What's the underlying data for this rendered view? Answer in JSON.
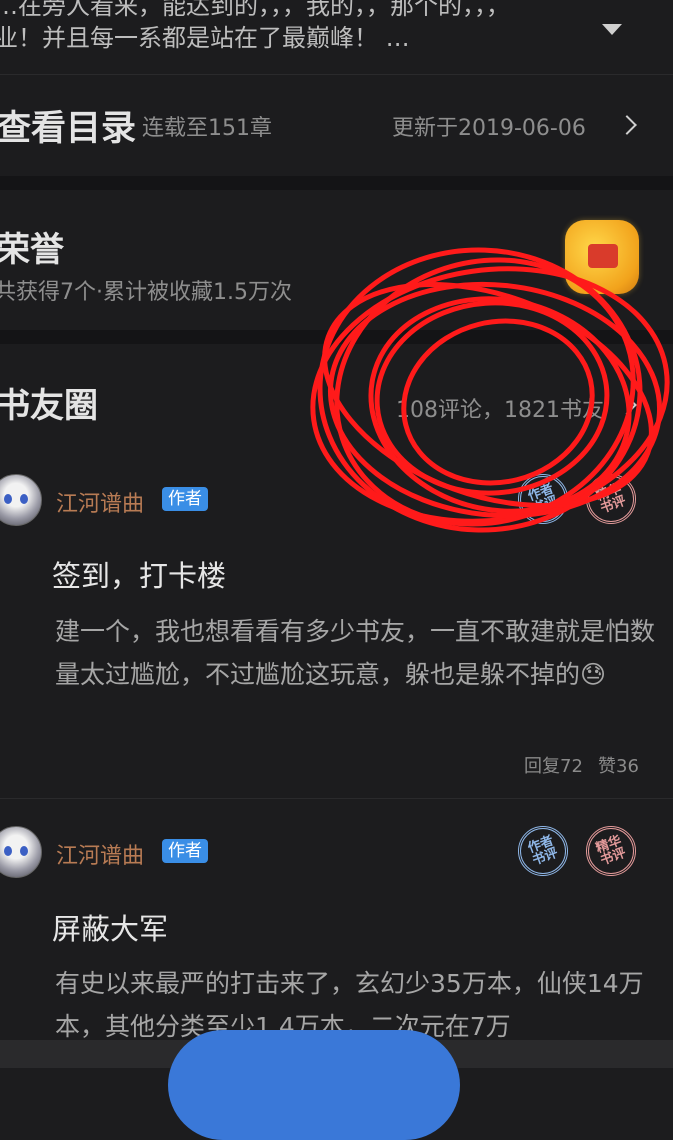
{
  "intro": {
    "line1": "…在旁人看来，能达到的，，，我的，，那个的，，，",
    "line2": "业！并且每一系都是站在了最巅峰！ …"
  },
  "toc": {
    "title": "查看目录",
    "serial": "连载至151章",
    "updated": "更新于2019-06-06"
  },
  "honor": {
    "title": "荣誉",
    "subtitle": "共获得7个·累计被收藏1.5万次"
  },
  "book_circle": {
    "title": "书友圈",
    "stats": "108评论，1821书友",
    "posts": [
      {
        "author": "江河谱曲",
        "tag": "作者",
        "stamp_author": "作者书评",
        "stamp_essence": "精华书评",
        "title": "签到，打卡楼",
        "body": "建一个，我也想看看有多少书友，一直不敢建就是怕数量太过尴尬，不过尴尬这玩意，躲也是躲不掉的😓",
        "replies": "回复72",
        "likes": "赞36"
      },
      {
        "author": "江河谱曲",
        "tag": "作者",
        "stamp_author": "作者书评",
        "stamp_essence": "精华书评",
        "title": "屏蔽大军",
        "body": "有史以来最严的打击来了，玄幻少35万本，仙侠14万本，其他分类至少1.4万本，二次元在7万"
      }
    ]
  },
  "colors": {
    "background": "#1c1c1e",
    "accent_blue": "#3a8ee6",
    "author_name": "#b87b54",
    "annotation_red": "#ff1a1a"
  }
}
